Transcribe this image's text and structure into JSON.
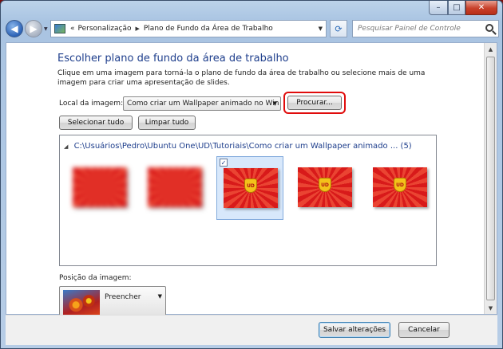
{
  "window": {
    "caption": {
      "minimize": "–",
      "maximize": "□",
      "close": "✕"
    }
  },
  "nav": {
    "back_icon": "◀",
    "forward_icon": "▶",
    "dropdown_icon": "▼",
    "breadcrumb_root": "«",
    "breadcrumb": [
      "Personalização",
      "Plano de Fundo da Área de Trabalho"
    ],
    "refresh_icon": "⟳",
    "search_placeholder": "Pesquisar Painel de Controle"
  },
  "main": {
    "heading": "Escolher plano de fundo da área de trabalho",
    "description": "Clique em uma imagem para torná-la o plano de fundo da área de trabalho ou selecione mais de uma imagem para criar uma apresentação de slides.",
    "location_label": "Local da imagem:",
    "location_value": "Como criar um Wallpaper animado no Win",
    "browse_label": "Procurar...",
    "select_all_label": "Selecionar tudo",
    "clear_all_label": "Limpar tudo",
    "folder_path": "C:\\Usuários\\Pedro\\Ubuntu One\\UD\\Tutoriais\\Como criar um Wallpaper animado ... (5)",
    "thumbnails": [
      {
        "selected": false,
        "blurred": true,
        "logo": ""
      },
      {
        "selected": false,
        "blurred": true,
        "logo": ""
      },
      {
        "selected": true,
        "blurred": false,
        "logo": "UD"
      },
      {
        "selected": false,
        "blurred": false,
        "logo": "UD"
      },
      {
        "selected": false,
        "blurred": false,
        "logo": "UD"
      }
    ],
    "position_label": "Posição da imagem:",
    "position_value": "Preencher"
  },
  "footer": {
    "save_label": "Salvar alterações",
    "cancel_label": "Cancelar"
  },
  "colors": {
    "highlight": "#e00c0c",
    "heading": "#1e3e8c"
  }
}
